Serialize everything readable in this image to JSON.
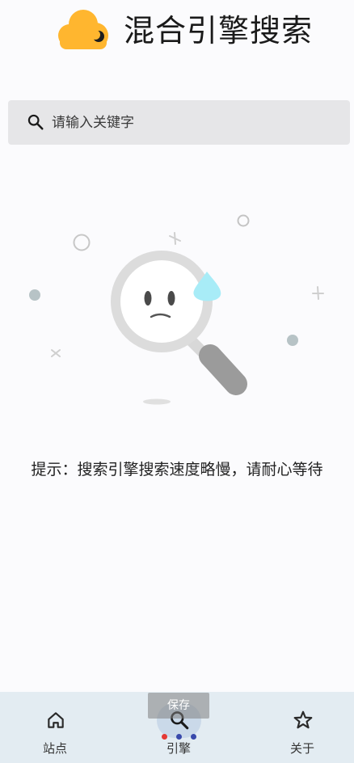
{
  "header": {
    "title": "混合引擎搜索",
    "logo_icon": "cloud-moon-icon"
  },
  "search": {
    "placeholder": "请输入关键字",
    "value": "",
    "icon": "search-icon"
  },
  "empty_state": {
    "illustration": "sad-magnifier-icon"
  },
  "hint": {
    "text": "提示：搜索引擎搜索速度略慢，请耐心等待"
  },
  "toast": {
    "text": "保存"
  },
  "loading_dots": {
    "colors": [
      "#e53935",
      "#3949ab",
      "#3949ab"
    ]
  },
  "bottom_nav": {
    "items": [
      {
        "label": "站点",
        "icon": "home-icon",
        "active": false
      },
      {
        "label": "引擎",
        "icon": "search-icon",
        "active": true
      },
      {
        "label": "关于",
        "icon": "star-icon",
        "active": false
      }
    ]
  },
  "colors": {
    "accent": "#ffb62f",
    "nav_bg": "#e3ecf2",
    "active_pill": "#cad9e9"
  }
}
